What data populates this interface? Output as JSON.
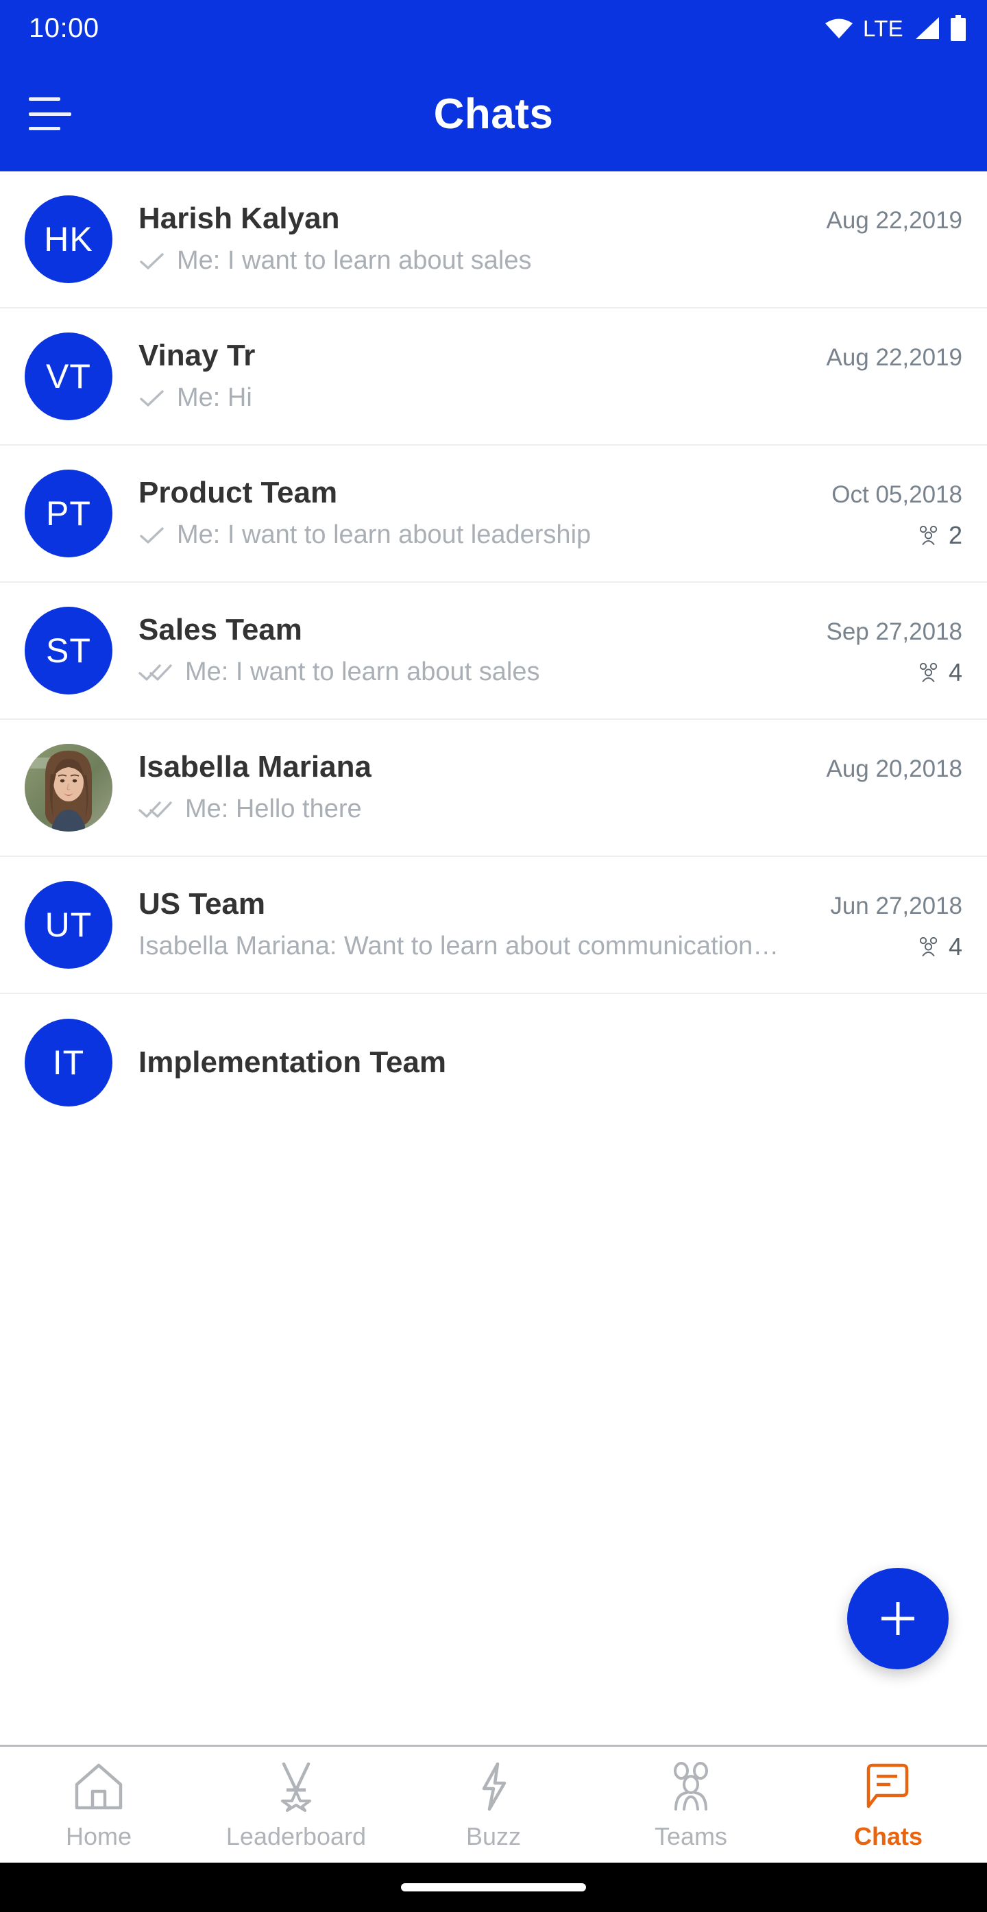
{
  "status_bar": {
    "time": "10:00",
    "network_label": "LTE",
    "icons": [
      "wifi-icon",
      "signal-icon",
      "battery-icon"
    ]
  },
  "app_bar": {
    "title": "Chats",
    "menu_icon": "hamburger-menu-icon"
  },
  "colors": {
    "brand_blue": "#0A34E0",
    "accent_orange": "#E8640F",
    "title_text": "#333333",
    "snippet_text": "#a9afb5",
    "date_text": "#79838d",
    "divider": "#eceef0"
  },
  "chats": [
    {
      "initials": "HK",
      "avatar_type": "initials",
      "name": "Harish Kalyan",
      "date": "Aug 22,2019",
      "tick": "single-check-icon",
      "snippet": "Me: I want to learn about sales",
      "members": null
    },
    {
      "initials": "VT",
      "avatar_type": "initials",
      "name": "Vinay  Tr",
      "date": "Aug 22,2019",
      "tick": "single-check-icon",
      "snippet": "Me: Hi",
      "members": null
    },
    {
      "initials": "PT",
      "avatar_type": "initials",
      "name": "Product Team",
      "date": "Oct 05,2018",
      "tick": "single-check-icon",
      "snippet": "Me: I want to learn about leadership",
      "members": "2"
    },
    {
      "initials": "ST",
      "avatar_type": "initials",
      "name": "Sales Team",
      "date": "Sep 27,2018",
      "tick": "double-check-icon",
      "snippet": "Me: I want to learn about sales",
      "members": "4"
    },
    {
      "initials": "",
      "avatar_type": "photo",
      "name": "Isabella Mariana",
      "date": "Aug 20,2018",
      "tick": "double-check-icon",
      "snippet": "Me: Hello there",
      "members": null
    },
    {
      "initials": "UT",
      "avatar_type": "initials",
      "name": "US Team",
      "date": "Jun 27,2018",
      "tick": "none",
      "snippet": "Isabella Mariana: Want to learn about communication…",
      "members": "4"
    },
    {
      "initials": "IT",
      "avatar_type": "initials",
      "name": "Implementation Team",
      "date": "",
      "tick": "none",
      "snippet": "",
      "members": null
    }
  ],
  "fab": {
    "icon": "plus-icon",
    "label": "New chat"
  },
  "bottom_nav": {
    "items": [
      {
        "label": "Home",
        "icon": "home-icon",
        "active": false
      },
      {
        "label": "Leaderboard",
        "icon": "medal-icon",
        "active": false
      },
      {
        "label": "Buzz",
        "icon": "lightning-icon",
        "active": false
      },
      {
        "label": "Teams",
        "icon": "people-icon",
        "active": false
      },
      {
        "label": "Chats",
        "icon": "chat-bubble-icon",
        "active": true
      }
    ]
  }
}
